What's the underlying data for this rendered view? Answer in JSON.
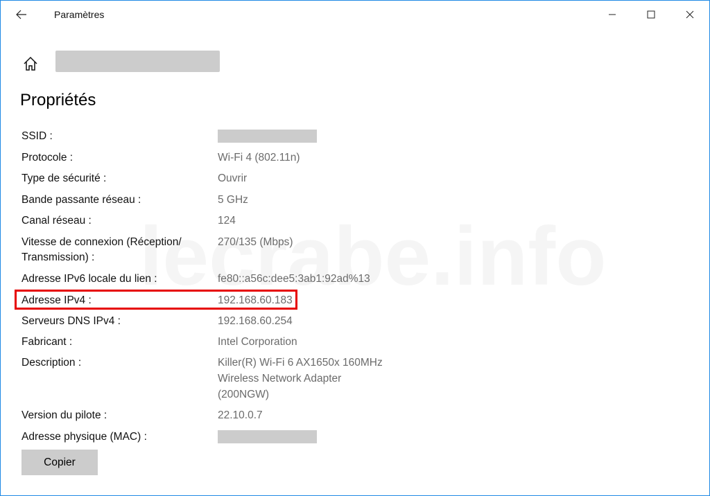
{
  "window": {
    "title": "Paramètres"
  },
  "page": {
    "title": "Propriétés"
  },
  "properties": [
    {
      "label": "SSID :",
      "value": "",
      "redacted": true
    },
    {
      "label": "Protocole :",
      "value": "Wi-Fi 4 (802.11n)"
    },
    {
      "label": "Type de sécurité :",
      "value": "Ouvrir"
    },
    {
      "label": "Bande passante réseau :",
      "value": "5 GHz"
    },
    {
      "label": "Canal réseau :",
      "value": "124"
    },
    {
      "label": "Vitesse de connexion (Réception/",
      "label2": "Transmission) :",
      "value": "270/135 (Mbps)"
    },
    {
      "label": "Adresse IPv6 locale du lien :",
      "value": "fe80::a56c:dee5:3ab1:92ad%13"
    },
    {
      "label": "Adresse IPv4 :",
      "value": "192.168.60.183",
      "highlighted": true
    },
    {
      "label": "Serveurs DNS IPv4 :",
      "value": "192.168.60.254"
    },
    {
      "label": "Fabricant :",
      "value": "Intel Corporation"
    },
    {
      "label": "Description :",
      "value": "Killer(R) Wi-Fi 6 AX1650x 160MHz",
      "value2": "Wireless Network Adapter",
      "value3": "(200NGW)"
    },
    {
      "label": "Version du pilote :",
      "value": "22.10.0.7"
    },
    {
      "label": "Adresse physique (MAC) :",
      "value": "",
      "redacted": true
    }
  ],
  "actions": {
    "copy_label": "Copier"
  },
  "watermark": "lecrabe.info",
  "colors": {
    "window_border": "#1e88e5",
    "highlight": "#e60000",
    "value_text": "#6b6b6b",
    "redaction": "#cccccc"
  }
}
